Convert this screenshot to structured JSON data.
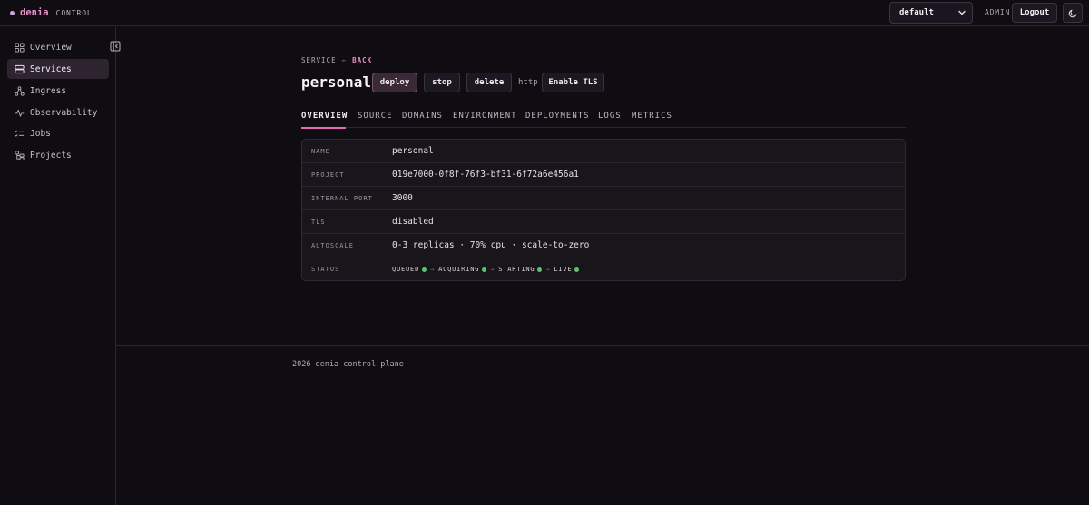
{
  "brand": {
    "name": "denia",
    "sub": "CONTROL"
  },
  "header": {
    "namespace_value": "default",
    "role": "ADMIN",
    "logout_label": "Logout"
  },
  "sidebar": {
    "items": [
      {
        "label": "Overview",
        "icon": "grid-icon"
      },
      {
        "label": "Services",
        "icon": "server-icon",
        "active": true
      },
      {
        "label": "Ingress",
        "icon": "network-icon"
      },
      {
        "label": "Observability",
        "icon": "activity-icon"
      },
      {
        "label": "Jobs",
        "icon": "list-check-icon"
      },
      {
        "label": "Projects",
        "icon": "folder-tree-icon"
      }
    ]
  },
  "breadcrumb": {
    "section": "SERVICE",
    "separator": "←",
    "back": "BACK"
  },
  "service": {
    "name": "personal",
    "actions": {
      "deploy": "deploy",
      "stop": "stop",
      "delete": "delete",
      "tls": "Enable TLS"
    },
    "protocol": "http"
  },
  "tabs": [
    "OVERVIEW",
    "SOURCE",
    "DOMAINS",
    "ENVIRONMENT",
    "DEPLOYMENTS",
    "LOGS",
    "METRICS"
  ],
  "details": [
    {
      "label": "NAME",
      "value": "personal"
    },
    {
      "label": "PROJECT",
      "value": "019e7000-0f8f-76f3-bf31-6f72a6e456a1"
    },
    {
      "label": "INTERNAL PORT",
      "value": "3000"
    },
    {
      "label": "TLS",
      "value": "disabled"
    },
    {
      "label": "AUTOSCALE",
      "value": "0-3 replicas · 70% cpu · scale-to-zero"
    },
    {
      "label": "STATUS"
    }
  ],
  "status_steps": [
    {
      "label": "QUEUED",
      "color": "#57c36b"
    },
    {
      "label": "ACQUIRING",
      "color": "#57c36b"
    },
    {
      "label": "STARTING",
      "color": "#57c36b"
    },
    {
      "label": "LIVE",
      "color": "#57c36b"
    }
  ],
  "status_separator": "→",
  "colors": {
    "accent": "#e06bb2",
    "background": "#100d12",
    "success": "#57c36b"
  },
  "footer": "2026 denia control plane"
}
